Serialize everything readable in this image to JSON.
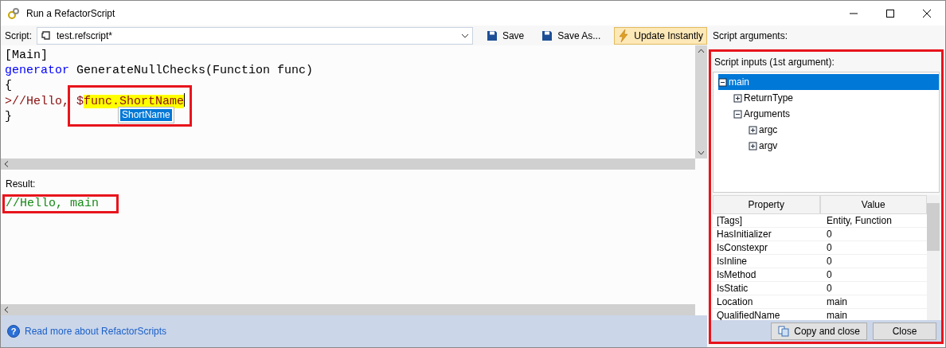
{
  "window": {
    "title": "Run a RefactorScript"
  },
  "toolbar": {
    "script_label": "Script:",
    "script_file": "test.refscript*",
    "buttons": [
      {
        "label": "Save",
        "kind": "save",
        "pressed": false
      },
      {
        "label": "Save As...",
        "kind": "save",
        "pressed": false
      },
      {
        "label": "Update Instantly",
        "kind": "lightning",
        "pressed": true
      }
    ]
  },
  "editor": {
    "lines": [
      [
        {
          "text": "[Main]",
          "kind": "plain"
        }
      ],
      [
        {
          "text": "generator",
          "kind": "keyword"
        },
        {
          "text": " GenerateNullChecks(Function func)",
          "kind": "plain"
        }
      ],
      [
        {
          "text": "{",
          "kind": "plain"
        }
      ],
      [
        {
          "text": ">//Hello, $",
          "kind": "template"
        },
        {
          "text": "func.ShortName",
          "kind": "highlight"
        }
      ],
      [
        {
          "text": "}",
          "kind": "plain"
        }
      ]
    ],
    "autocomplete": [
      {
        "label": "ShortName",
        "selected": true
      }
    ]
  },
  "result": {
    "label": "Result:",
    "lines": [
      "//Hello, main"
    ]
  },
  "footer": {
    "help_glyph": "?",
    "link": "Read more about RefactorScripts"
  },
  "arguments": {
    "label": "Script arguments:",
    "inputs_label": "Script inputs (1st argument):",
    "tree": [
      {
        "label": "main",
        "expanded": true,
        "selected": true,
        "children": [
          {
            "label": "ReturnType",
            "expanded": false,
            "selected": false
          },
          {
            "label": "Arguments",
            "expanded": true,
            "selected": false,
            "children": [
              {
                "label": "argc",
                "expanded": false,
                "selected": false
              },
              {
                "label": "argv",
                "expanded": false,
                "selected": false
              }
            ]
          }
        ]
      }
    ],
    "properties": {
      "columns": [
        "Property",
        "Value"
      ],
      "rows": [
        [
          "[Tags]",
          "Entity, Function"
        ],
        [
          "HasInitializer",
          "0"
        ],
        [
          "IsConstexpr",
          "0"
        ],
        [
          "IsInline",
          "0"
        ],
        [
          "IsMethod",
          "0"
        ],
        [
          "IsStatic",
          "0"
        ],
        [
          "Location",
          "main"
        ],
        [
          "QualifiedName",
          "main"
        ]
      ]
    },
    "buttons": [
      {
        "label": "Copy and close",
        "kind": "copy"
      },
      {
        "label": "Close",
        "kind": "plain"
      }
    ]
  }
}
